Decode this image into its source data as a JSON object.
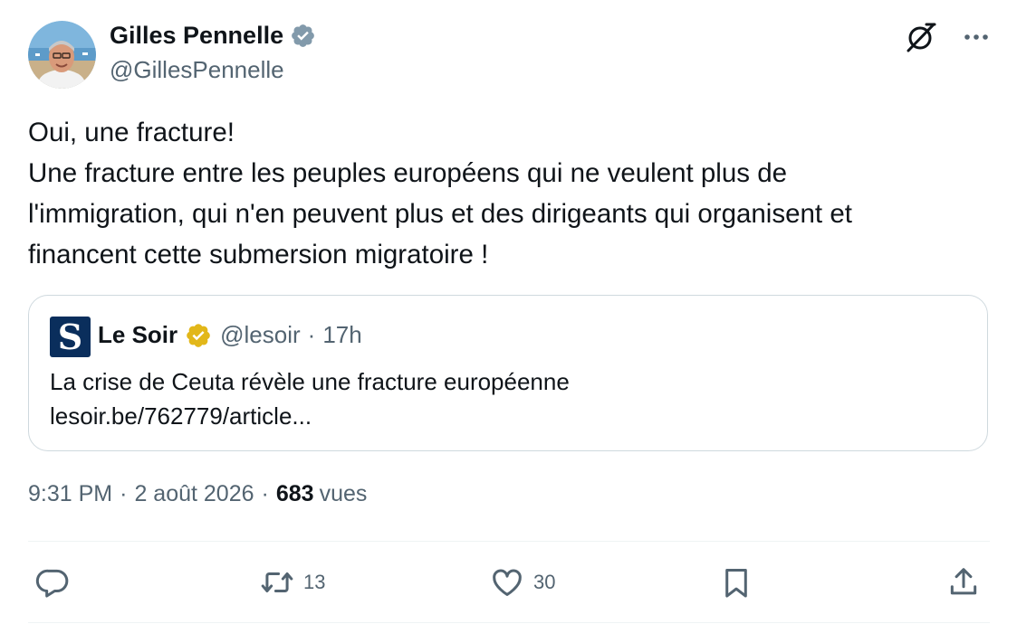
{
  "author": {
    "name": "Gilles Pennelle",
    "handle": "@GillesPennelle",
    "verified": true
  },
  "tweet": {
    "lines": [
      "Oui, une fracture!",
      "Une fracture entre les peuples européens qui ne veulent plus de",
      "l'immigration, qui n'en peuvent plus et des dirigeants qui organisent et",
      "financent cette submersion migratoire !"
    ]
  },
  "quote": {
    "logo_letter": "S",
    "name": "Le Soir",
    "handle": "@lesoir",
    "separator": "·",
    "time": "17h",
    "text": "La crise de Ceuta révèle une fracture européenne",
    "link": "lesoir.be/762779/article..."
  },
  "meta": {
    "time": "9:31 PM",
    "date": "2 août 2026",
    "separator": "·",
    "views_count": "683",
    "views_label": "vues"
  },
  "actions": {
    "reply_count": "",
    "retweet_count": "13",
    "like_count": "30"
  },
  "colors": {
    "text_primary": "#0f1419",
    "text_secondary": "#536471",
    "border": "#cfd9de",
    "verified_gray": "#829aab",
    "verified_gold": "#e2b719",
    "lesoir_blue": "#0a2e5c"
  },
  "icons": {
    "verified": "verified-badge-icon",
    "grok": "grok-icon",
    "more": "more-icon",
    "reply": "reply-icon",
    "retweet": "retweet-icon",
    "like": "like-icon",
    "bookmark": "bookmark-icon",
    "share": "share-icon"
  }
}
